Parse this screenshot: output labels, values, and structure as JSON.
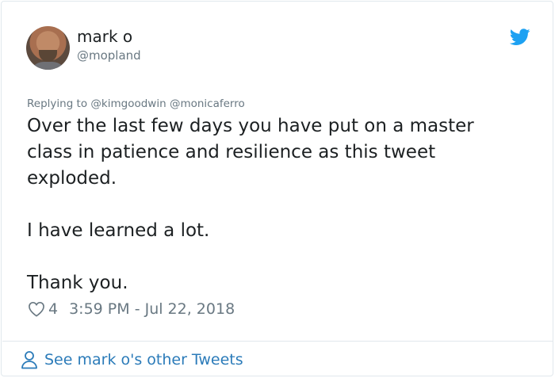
{
  "tweet": {
    "author": {
      "display_name": "mark o",
      "handle": "@mopland"
    },
    "brand_icon": "twitter-bird-icon",
    "replying_to": {
      "prefix": "Replying to",
      "mentions": [
        "@kimgoodwin",
        "@monicaferro"
      ]
    },
    "text": "Over the last few days you have put on a master\nclass in patience and resilience as this tweet\nexploded.\n\nI have learned a lot.\n\nThank you.",
    "likes": "4",
    "timestamp": "3:59 PM - Jul 22, 2018"
  },
  "footer": {
    "link_label": "See mark o's other Tweets",
    "icon": "person-icon"
  },
  "colors": {
    "accent": "#1da1f2",
    "link": "#2b7bb9",
    "secondary_text": "#697882",
    "border": "#e1e8ed"
  }
}
